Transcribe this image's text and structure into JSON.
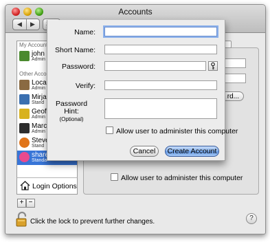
{
  "window": {
    "title": "Accounts"
  },
  "toolbar": {
    "back_glyph": "◀",
    "forward_glyph": "▶",
    "show_all_label": "Sh"
  },
  "sidebar": {
    "my_account_header": "My Account",
    "other_accounts_header": "Other Accounts",
    "items": [
      {
        "name": "john",
        "role": "Admin",
        "avatar_color": "#4a8a2e",
        "selected": false
      },
      {
        "name": "Local",
        "role": "Admin",
        "avatar_color": "#8a6a42",
        "selected": false
      },
      {
        "name": "Mirja",
        "role": "Stand",
        "avatar_color": "#3a6fb0",
        "selected": false
      },
      {
        "name": "Geoff",
        "role": "Admin",
        "avatar_color": "#d8b21f",
        "selected": false
      },
      {
        "name": "March",
        "role": "Admin",
        "avatar_color": "#2e2e2e",
        "selected": false
      },
      {
        "name": "Steve",
        "role": "Stand",
        "avatar_color": "#e0741a",
        "selected": false
      },
      {
        "name": "share",
        "role": "Standa",
        "avatar_color": "#e94a8e",
        "selected": true
      }
    ],
    "login_options_label": "Login Options",
    "add_label": "+",
    "remove_label": "−"
  },
  "background": {
    "password_button_label": "rd...",
    "admin_checkbox_label": "Allow user to administer this computer"
  },
  "sheet": {
    "name_label": "Name:",
    "short_name_label": "Short Name:",
    "password_label": "Password:",
    "verify_label": "Verify:",
    "hint_label": "Password Hint:",
    "hint_optional": "(Optional)",
    "admin_checkbox_label": "Allow user to administer this computer",
    "cancel_label": "Cancel",
    "create_label": "Create Account"
  },
  "footer": {
    "lock_text": "Click the lock to prevent further changes.",
    "help_label": "?"
  },
  "colors": {
    "selection": "#3875d7",
    "default_button": "#6599e3"
  }
}
